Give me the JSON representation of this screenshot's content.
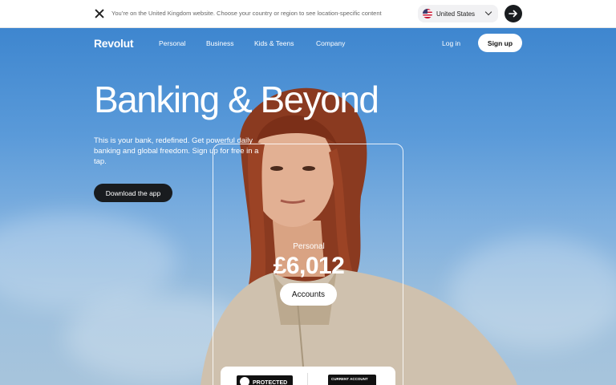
{
  "banner": {
    "message": "You’re on the United Kingdom website. Choose your country or region to see location-specific content",
    "country": "United States"
  },
  "nav": {
    "logo": "Revolut",
    "items": [
      "Personal",
      "Business",
      "Kids & Teens",
      "Company"
    ],
    "login": "Log in",
    "signup": "Sign up"
  },
  "hero": {
    "headline": "Banking & Beyond",
    "subtext": "This is your bank, redefined. Get powerful daily banking and global freedom. Sign up for free in a tap.",
    "cta": "Download the app"
  },
  "card": {
    "label": "Personal",
    "amount": "£6,012",
    "button": "Accounts"
  },
  "badges": {
    "protected": "PROTECTED",
    "current_account": "CURRENT ACCOUNT"
  },
  "colors": {
    "sky": "#4a8fd3",
    "dark_button": "#191c1f"
  }
}
